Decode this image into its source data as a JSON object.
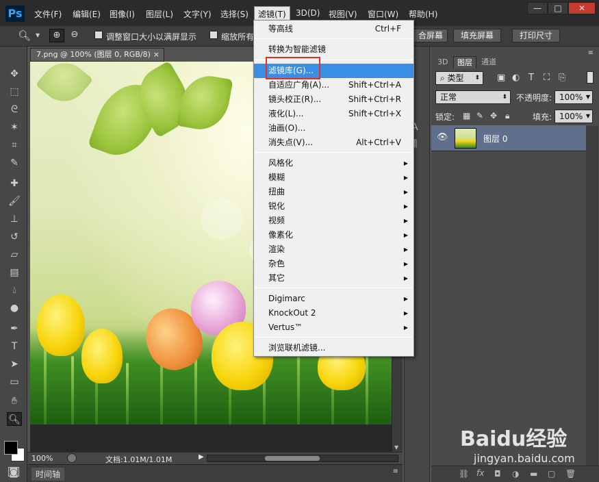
{
  "app": {
    "logo": "Ps"
  },
  "menubar": {
    "items": [
      "文件(F)",
      "编辑(E)",
      "图像(I)",
      "图层(L)",
      "文字(Y)",
      "选择(S)",
      "滤镜(T)",
      "3D(D)",
      "视图(V)",
      "窗口(W)",
      "帮助(H)"
    ],
    "active_index": 6,
    "window_buttons": [
      "—",
      "□",
      "✕"
    ]
  },
  "options_bar": {
    "resize_windows_label": "调整窗口大小以满屏显示",
    "zoom_all_label": "缩放所有",
    "fill_screen_label": "填充屏幕",
    "fit_screen_label": "合屏幕",
    "print_size_label": "打印尺寸"
  },
  "document": {
    "tab_title": "7.png @ 100% (图层 0, RGB/8)",
    "tab_close": "×",
    "zoom": "100%",
    "doc_info": "文档:1.01M/1.01M"
  },
  "timeline": {
    "label": "时间轴"
  },
  "layers_panel": {
    "tabs": [
      "3D",
      "图层",
      "通道"
    ],
    "active_tab_index": 1,
    "kind_filter": "类型",
    "blend_mode": "正常",
    "opacity_label": "不透明度:",
    "opacity_value": "100%",
    "lock_label": "锁定:",
    "fill_label": "填充:",
    "fill_value": "100%",
    "layers": [
      {
        "name": "图层 0",
        "visible": true
      }
    ]
  },
  "filter_menu": {
    "groups": [
      [
        {
          "label": "等高线",
          "shortcut": "Ctrl+F"
        }
      ],
      [
        {
          "label": "转换为智能滤镜",
          "shortcut": ""
        }
      ],
      [
        {
          "label": "滤镜库(G)...",
          "shortcut": "",
          "highlighted": true
        },
        {
          "label": "自适应广角(A)...",
          "shortcut": "Shift+Ctrl+A"
        },
        {
          "label": "镜头校正(R)...",
          "shortcut": "Shift+Ctrl+R"
        },
        {
          "label": "液化(L)...",
          "shortcut": "Shift+Ctrl+X"
        },
        {
          "label": "油画(O)...",
          "shortcut": ""
        },
        {
          "label": "消失点(V)...",
          "shortcut": "Alt+Ctrl+V"
        }
      ],
      [
        {
          "label": "风格化",
          "submenu": true
        },
        {
          "label": "模糊",
          "submenu": true
        },
        {
          "label": "扭曲",
          "submenu": true
        },
        {
          "label": "锐化",
          "submenu": true
        },
        {
          "label": "视频",
          "submenu": true
        },
        {
          "label": "像素化",
          "submenu": true
        },
        {
          "label": "渲染",
          "submenu": true
        },
        {
          "label": "杂色",
          "submenu": true
        },
        {
          "label": "其它",
          "submenu": true
        }
      ],
      [
        {
          "label": "Digimarc",
          "submenu": true
        },
        {
          "label": "KnockOut 2",
          "submenu": true
        },
        {
          "label": "Vertus™",
          "submenu": true
        }
      ],
      [
        {
          "label": "浏览联机滤镜...",
          "shortcut": ""
        }
      ]
    ]
  },
  "watermark": {
    "brand": "Baidu经验",
    "url": "jingyan.baidu.com"
  },
  "colors": {
    "highlight": "#3a8ee6",
    "annotation_box": "#e03020",
    "selected_layer": "#5f6f8c"
  }
}
